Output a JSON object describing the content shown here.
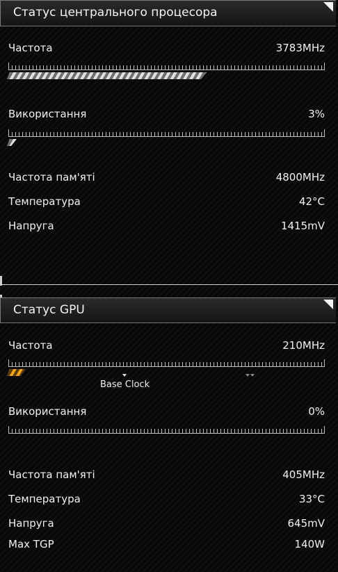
{
  "cpu": {
    "title": "Статус центрального процесора",
    "frequency": {
      "label": "Частота",
      "value": "3783MHz",
      "fill_fraction": 0.63
    },
    "usage": {
      "label": "Використання",
      "value": "3%",
      "fill_fraction": 0.03
    },
    "memory_frequency": {
      "label": "Частота пам'яті",
      "value": "4800MHz"
    },
    "temperature": {
      "label": "Температура",
      "value": "42°C"
    },
    "voltage": {
      "label": "Напруга",
      "value": "1415mV"
    }
  },
  "gpu": {
    "title": "Статус GPU",
    "frequency": {
      "label": "Частота",
      "value": "210MHz",
      "fill_fraction": 0.06
    },
    "base_clock_label": "Base Clock",
    "usage": {
      "label": "Використання",
      "value": "0%",
      "fill_fraction": 0.0
    },
    "memory_frequency": {
      "label": "Частота пам'яті",
      "value": "405MHz"
    },
    "temperature": {
      "label": "Температура",
      "value": "33°C"
    },
    "voltage": {
      "label": "Напруга",
      "value": "645mV"
    },
    "max_tgp": {
      "label": "Max TGP",
      "value": "140W"
    }
  },
  "colors": {
    "gpu_bar": "#f2a21c",
    "cpu_bar": "#cfcfcf"
  }
}
